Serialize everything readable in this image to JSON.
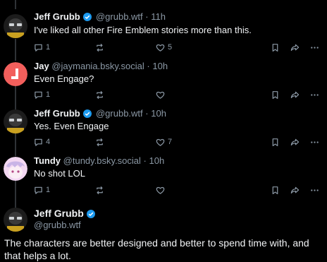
{
  "posts": [
    {
      "author": "Jeff Grubb",
      "verified": true,
      "handle": "@grubb.wtf",
      "separator": "·",
      "time": "11h",
      "text": "I've liked all other Fire Emblem stories more than this.",
      "reply_count": "1",
      "repost_count": "",
      "like_count": "5"
    },
    {
      "author": "Jay",
      "verified": false,
      "handle": "@jaymania.bsky.social",
      "separator": "·",
      "time": "10h",
      "text": "Even Engage?",
      "reply_count": "1",
      "repost_count": "",
      "like_count": ""
    },
    {
      "author": "Jeff Grubb",
      "verified": true,
      "handle": "@grubb.wtf",
      "separator": "·",
      "time": "10h",
      "text": "Yes. Even Engage",
      "reply_count": "4",
      "repost_count": "",
      "like_count": "7"
    },
    {
      "author": "Tundy",
      "verified": false,
      "handle": "@tundy.bsky.social",
      "separator": "·",
      "time": "10h",
      "text": "No shot LOL",
      "reply_count": "1",
      "repost_count": "",
      "like_count": ""
    }
  ],
  "main_post": {
    "author": "Jeff Grubb",
    "verified": true,
    "handle": "@grubb.wtf",
    "text": "The characters are better designed and better to spend time with, and that helps a lot."
  },
  "icons": {
    "reply": "reply-icon",
    "repost": "repost-icon",
    "like": "heart-icon",
    "bookmark": "bookmark-icon",
    "share": "share-icon",
    "more": "more-icon",
    "verified": "verified-badge-icon"
  },
  "colors": {
    "background": "#000000",
    "text": "#f1f3f5",
    "muted": "#8b98a5",
    "verified": "#1d9bf0",
    "thread_line": "#2f3336",
    "jay_avatar": "#f25f5c",
    "tundy_avatar": "#f3d7f2"
  }
}
